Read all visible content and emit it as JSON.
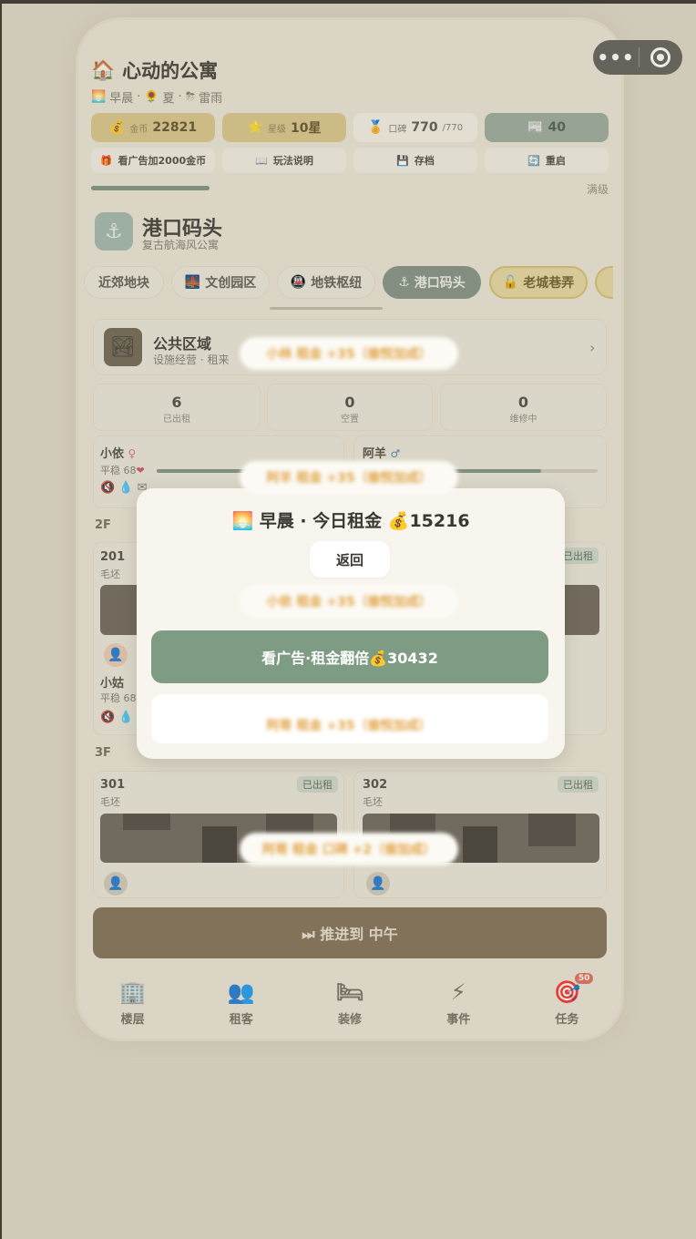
{
  "capsule": {
    "menu_icon": "more-dots-icon",
    "close_icon": "target-icon"
  },
  "header": {
    "title_icon": "🏠",
    "title": "心动的公寓",
    "time_icon": "🌅",
    "time": "早晨",
    "season_icon": "🌻",
    "season": "夏",
    "weather_icon": "⛈",
    "weather": "雷雨",
    "dot": "·"
  },
  "stats": {
    "coin_label": "金币",
    "coin_value": "22821",
    "star_label": "星级",
    "star_value": "10星",
    "rep_label": "口碑",
    "rep_value": "770",
    "rep_max": "/770",
    "news_value": "40"
  },
  "actions": {
    "ad_coins": "看广告加2000金币",
    "help": "玩法说明",
    "save": "存档",
    "restart": "重启"
  },
  "progress": {
    "full_label": "满级",
    "fraction": 1.0
  },
  "district": {
    "name": "港口码头",
    "subtitle": "复古航海风公寓"
  },
  "tabs": [
    "近郊地块",
    "文创园区",
    "地铁枢纽",
    "港口码头",
    "老城巷弄"
  ],
  "public_area": {
    "title": "公共区域",
    "subtitle": "设施经营 · 租来"
  },
  "counts": [
    {
      "value": "6",
      "label": "已出租"
    },
    {
      "value": "0",
      "label": "空置"
    },
    {
      "value": "0",
      "label": "维修中"
    }
  ],
  "tenants_top": [
    {
      "name": "小依",
      "gender": "♀",
      "mood": "平稳 68"
    },
    {
      "name": "阿羊",
      "gender": "♂"
    }
  ],
  "floors": {
    "f2": "2F",
    "f3": "3F"
  },
  "rooms": {
    "r201": "201",
    "r201_state": "毛坯",
    "r201_tag": "已出租",
    "tenant2": "小姑",
    "tenant2_mood": "平稳 68",
    "r301": "301",
    "r301_state": "毛坯",
    "r301_tag": "已出租",
    "r302": "302",
    "r302_state": "毛坯",
    "r302_tag": "已出租"
  },
  "advance_button": "⏭ 推进到 中午",
  "nav": [
    {
      "icon": "🏢",
      "label": "楼层"
    },
    {
      "icon": "👥",
      "label": "租客"
    },
    {
      "icon": "🛏",
      "label": "装修"
    },
    {
      "icon": "⚡",
      "label": "事件"
    },
    {
      "icon": "🎯",
      "label": "任务",
      "badge": "50"
    }
  ],
  "modal": {
    "title": "🌅 早晨 · 今日租金 💰15216",
    "back": "返回",
    "ad_double": "看广告·租金翻倍💰30432"
  },
  "toasts": [
    "小林 租金 +35（偷悦加成）",
    "阿羊 租金 +35（偷悦加成）",
    "小依 租金 +35（偷悦加成）",
    "阿哥 租金 +35（偷悦加成）",
    "阿哥 租金 口碑 +2（偷加成）"
  ]
}
